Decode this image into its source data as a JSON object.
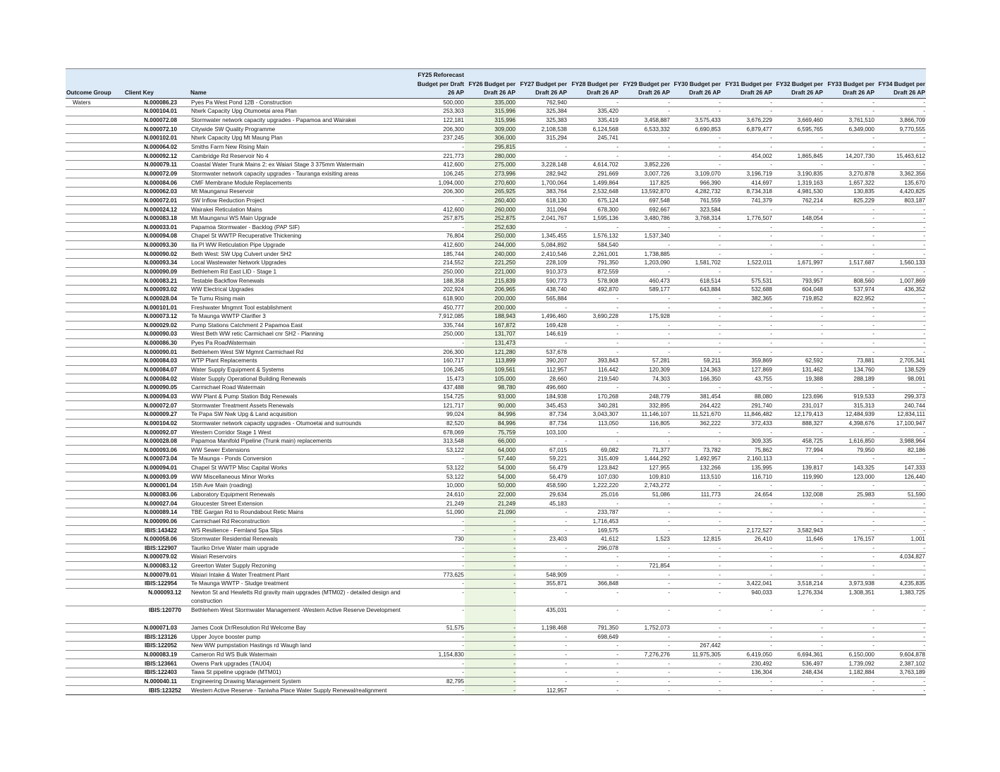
{
  "headers": {
    "outcome_group": "Outcome Group",
    "client_key": "Client Key",
    "name": "Name",
    "fy25": "FY25 Reforecast Budget per Draft 26 AP",
    "fy26": "FY26 Budget per Draft 26 AP",
    "fy27": "FY27 Budget per Draft 26 AP",
    "fy28": "FY28 Budget per Draft 26 AP",
    "fy29": "FY29 Budget per Draft 26 AP",
    "fy30": "FY30 Budget per Draft 26 AP",
    "fy31": "FY31 Budget per Draft 26 AP",
    "fy32": "FY32 Budget per Draft 26 AP",
    "fy33": "FY33 Budget per Draft 26 AP",
    "fy34": "FY34 Budget per Draft 26 AP"
  },
  "colors": {
    "header_bg": "#dce9f6",
    "fy26_highlight": "#ebf5e2"
  },
  "rows": [
    [
      "Waters",
      "N.000086.23",
      "Pyes Pa West Pond 12B - Construction",
      "500,000",
      "335,000",
      "762,940",
      "-",
      "-",
      "-",
      "-",
      "-",
      "-",
      "-"
    ],
    [
      "",
      "N.000104.01",
      "Ntwrk Capacity Upg Otumoetai area Plan",
      "253,303",
      "315,996",
      "325,384",
      "335,420",
      "-",
      "-",
      "-",
      "-",
      "-",
      "-"
    ],
    [
      "",
      "N.000072.08",
      "Stormwater network capacity upgrades - Papamoa and Wairakei",
      "122,181",
      "315,996",
      "325,383",
      "335,419",
      "3,458,887",
      "3,575,433",
      "3,676,229",
      "3,669,460",
      "3,761,510",
      "3,866,709"
    ],
    [
      "",
      "N.000072.10",
      "Citywide SW Quality Programme",
      "206,300",
      "309,000",
      "2,108,538",
      "6,124,568",
      "6,533,332",
      "6,690,853",
      "6,879,477",
      "6,595,765",
      "6,349,000",
      "9,770,555"
    ],
    [
      "",
      "N.000102.01",
      "Ntwrk Capacity Upg Mt Maung Plan",
      "237,245",
      "306,000",
      "315,294",
      "245,741",
      "-",
      "-",
      "-",
      "-",
      "-",
      "-"
    ],
    [
      "",
      "N.000064.02",
      "Smiths Farm New Rising Main",
      "-",
      "295,815",
      "-",
      "-",
      "-",
      "-",
      "-",
      "-",
      "-",
      "-"
    ],
    [
      "",
      "N.000092.12",
      "Cambridge Rd Reservoir No 4",
      "221,773",
      "280,000",
      "-",
      "-",
      "-",
      "-",
      "454,002",
      "1,865,845",
      "14,207,730",
      "15,463,612"
    ],
    [
      "",
      "N.000079.11",
      "Coastal Water Trunk Mains 2: ex Waiari Stage 3 375mm Watermain",
      "412,600",
      "275,000",
      "3,228,148",
      "4,614,702",
      "3,852,226",
      "-",
      "-",
      "-",
      "-",
      "-"
    ],
    [
      "",
      "N.000072.09",
      "Stormwater network capacity upgrades - Tauranga exisiting areas",
      "106,245",
      "273,996",
      "282,942",
      "291,669",
      "3,007,726",
      "3,109,070",
      "3,196,719",
      "3,190,835",
      "3,270,878",
      "3,362,356"
    ],
    [
      "",
      "N.000084.06",
      "CMF Membrane Module Replacements",
      "1,094,000",
      "270,600",
      "1,700,064",
      "1,499,864",
      "117,825",
      "966,390",
      "414,697",
      "1,319,163",
      "1,657,322",
      "135,670"
    ],
    [
      "",
      "N.000062.03",
      "Mt Maunganui Reservoir",
      "206,300",
      "265,925",
      "383,764",
      "2,532,648",
      "13,592,870",
      "4,282,732",
      "8,734,318",
      "4,981,530",
      "130,835",
      "4,420,825"
    ],
    [
      "",
      "N.000072.01",
      "SW Inflow Reduction Project",
      "-",
      "260,400",
      "618,130",
      "675,124",
      "697,548",
      "761,559",
      "741,379",
      "762,214",
      "825,229",
      "803,187"
    ],
    [
      "",
      "N.000024.12",
      "Wairakei Reticulation Mains",
      "412,600",
      "260,000",
      "311,094",
      "678,300",
      "692,667",
      "323,584",
      "-",
      "-",
      "-",
      "-"
    ],
    [
      "",
      "N.000083.18",
      "Mt Maunganui WS Main Upgrade",
      "257,875",
      "252,875",
      "2,041,767",
      "1,595,136",
      "3,480,786",
      "3,768,314",
      "1,776,507",
      "148,054",
      "-",
      "-"
    ],
    [
      "",
      "N.000033.01",
      "Papamoa Stormwater - Backlog (PAP SIF)",
      "-",
      "252,630",
      "-",
      "-",
      "-",
      "-",
      "-",
      "-",
      "-",
      "-"
    ],
    [
      "",
      "N.000094.08",
      "Chapel St WWTP Recuperative Thickening",
      "76,804",
      "250,000",
      "1,345,455",
      "1,576,132",
      "1,537,340",
      "-",
      "-",
      "-",
      "-",
      "-"
    ],
    [
      "",
      "N.000093.30",
      "Ila Pl WW Reticulation Pipe Upgrade",
      "412,600",
      "244,000",
      "5,084,892",
      "584,540",
      "-",
      "-",
      "-",
      "-",
      "-",
      "-"
    ],
    [
      "",
      "N.000090.02",
      "Beth West: SW Upg Culvert under SH2",
      "185,744",
      "240,000",
      "2,410,546",
      "2,261,001",
      "1,738,885",
      "-",
      "-",
      "-",
      "-",
      "-"
    ],
    [
      "",
      "N.000093.34",
      "Local Wastewater Network Upgrades",
      "214,552",
      "221,250",
      "228,109",
      "791,350",
      "1,203,090",
      "1,581,702",
      "1,522,011",
      "1,671,997",
      "1,517,687",
      "1,560,133"
    ],
    [
      "",
      "N.000090.09",
      "Bethlehem Rd East LID - Stage 1",
      "250,000",
      "221,000",
      "910,373",
      "872,559",
      "-",
      "-",
      "-",
      "-",
      "-",
      "-"
    ],
    [
      "",
      "N.000083.21",
      "Testable Backflow Renewals",
      "188,358",
      "215,839",
      "590,773",
      "578,908",
      "460,473",
      "618,514",
      "575,531",
      "793,957",
      "808,560",
      "1,007,869"
    ],
    [
      "",
      "N.000093.02",
      "WW Electrical Upgrades",
      "202,924",
      "206,965",
      "438,740",
      "492,870",
      "589,177",
      "643,884",
      "532,688",
      "604,048",
      "537,974",
      "436,352"
    ],
    [
      "",
      "N.000028.04",
      "Te Tumu Rising main",
      "618,900",
      "200,000",
      "565,884",
      "-",
      "-",
      "-",
      "382,365",
      "719,852",
      "822,952",
      "-"
    ],
    [
      "",
      "N.000101.01",
      "Freshwater Mngmnt Tool establishment",
      "450,777",
      "200,000",
      "-",
      "-",
      "-",
      "-",
      "-",
      "-",
      "-",
      "-"
    ],
    [
      "",
      "N.000073.12",
      "Te Maunga WWTP Clarifier 3",
      "7,912,085",
      "188,943",
      "1,496,460",
      "3,690,228",
      "175,928",
      "-",
      "-",
      "-",
      "-",
      "-"
    ],
    [
      "",
      "N.000029.02",
      "Pump Stations Catchment 2 Papamoa East",
      "335,744",
      "167,872",
      "169,428",
      "-",
      "-",
      "-",
      "-",
      "-",
      "-",
      "-"
    ],
    [
      "",
      "N.000090.03",
      "West Beth WW retic Carmichael cnr SH2 - Planning",
      "250,000",
      "131,707",
      "146,619",
      "-",
      "-",
      "-",
      "-",
      "-",
      "-",
      "-"
    ],
    [
      "",
      "N.000086.30",
      "Pyes Pa RoadWatermain",
      "-",
      "131,473",
      "-",
      "-",
      "-",
      "-",
      "-",
      "-",
      "-",
      "-"
    ],
    [
      "",
      "N.000090.01",
      "Bethlehem West SW Mgmnt Carmichael Rd",
      "206,300",
      "121,280",
      "537,678",
      "-",
      "-",
      "-",
      "-",
      "-",
      "-",
      "-"
    ],
    [
      "",
      "N.000084.03",
      "WTP Plant Replacements",
      "160,717",
      "113,899",
      "390,207",
      "393,843",
      "57,281",
      "59,211",
      "359,869",
      "62,592",
      "73,881",
      "2,705,341"
    ],
    [
      "",
      "N.000084.07",
      "Water Supply Equipment & Systems",
      "106,245",
      "109,561",
      "112,957",
      "116,442",
      "120,309",
      "124,363",
      "127,869",
      "131,462",
      "134,760",
      "138,529"
    ],
    [
      "",
      "N.000084.02",
      "Water Supply Operational Building Renewals",
      "15,473",
      "105,000",
      "28,660",
      "219,540",
      "74,303",
      "166,350",
      "43,755",
      "19,388",
      "288,189",
      "98,091"
    ],
    [
      "",
      "N.000090.05",
      "Carmichael Road Watermain",
      "437,488",
      "98,780",
      "496,660",
      "-",
      "-",
      "-",
      "-",
      "-",
      "-",
      "-"
    ],
    [
      "",
      "N.000094.03",
      "WW Plant & Pump Station Bdg Renewals",
      "154,725",
      "93,000",
      "184,938",
      "170,268",
      "248,779",
      "381,454",
      "88,080",
      "123,696",
      "919,533",
      "299,373"
    ],
    [
      "",
      "N.000072.07",
      "Stormwater Treatment Assets Renewals",
      "121,717",
      "90,000",
      "345,453",
      "340,281",
      "332,895",
      "264,422",
      "291,740",
      "231,017",
      "315,313",
      "240,744"
    ],
    [
      "",
      "N.000009.27",
      "Te Papa SW Nwk Upg & Land acquisition",
      "99,024",
      "84,996",
      "87,734",
      "3,043,307",
      "11,146,107",
      "11,521,670",
      "11,846,482",
      "12,179,413",
      "12,484,939",
      "12,834,111"
    ],
    [
      "",
      "N.000104.02",
      "Stormwater network capacity upgrades - Otumoetai and surrounds",
      "82,520",
      "84,996",
      "87,734",
      "113,050",
      "116,805",
      "362,222",
      "372,433",
      "888,327",
      "4,398,676",
      "17,100,947"
    ],
    [
      "",
      "N.000092.07",
      "Western Corridor Stage 1  West",
      "678,069",
      "75,759",
      "103,100",
      "-",
      "-",
      "-",
      "-",
      "-",
      "-",
      "-"
    ],
    [
      "",
      "N.000028.08",
      "Papamoa Manifold Pipeline (Trunk main) replacements",
      "313,548",
      "66,000",
      "-",
      "-",
      "-",
      "-",
      "309,335",
      "458,725",
      "1,616,850",
      "3,988,964"
    ],
    [
      "",
      "N.000093.06",
      "WW Sewer Extensions",
      "53,122",
      "64,000",
      "67,015",
      "69,082",
      "71,377",
      "73,782",
      "75,862",
      "77,994",
      "79,950",
      "82,186"
    ],
    [
      "",
      "N.000073.04",
      "Te Maunga - Ponds Conversion",
      "-",
      "57,440",
      "59,221",
      "315,409",
      "1,444,292",
      "1,492,957",
      "2,160,113",
      "-",
      "-",
      "-"
    ],
    [
      "",
      "N.000094.01",
      "Chapel St WWTP Misc Capital Works",
      "53,122",
      "54,000",
      "56,479",
      "123,842",
      "127,955",
      "132,266",
      "135,995",
      "139,817",
      "143,325",
      "147,333"
    ],
    [
      "",
      "N.000093.09",
      "WW Miscellaneous Minor Works",
      "53,122",
      "54,000",
      "56,479",
      "107,030",
      "109,810",
      "113,510",
      "116,710",
      "119,990",
      "123,000",
      "126,440"
    ],
    [
      "",
      "N.000001.04",
      "15th Ave Main (roading)",
      "10,000",
      "50,000",
      "458,590",
      "1,222,220",
      "2,743,272",
      "-",
      "-",
      "-",
      "-",
      "-"
    ],
    [
      "",
      "N.000083.06",
      "Laboratory Equipment Renewals",
      "24,610",
      "22,000",
      "29,634",
      "25,016",
      "51,086",
      "111,773",
      "24,654",
      "132,008",
      "25,983",
      "51,590"
    ],
    [
      "",
      "N.000027.04",
      "Gloucester Street Extension",
      "21,249",
      "21,249",
      "45,183",
      "-",
      "-",
      "-",
      "-",
      "-",
      "-",
      "-"
    ],
    [
      "",
      "N.000089.14",
      "TBE Gargan Rd to Roundabout Retic Mains",
      "51,090",
      "21,090",
      "-",
      "233,787",
      "-",
      "-",
      "-",
      "-",
      "-",
      "-"
    ],
    [
      "",
      "N.000090.06",
      "Carmichael Rd Reconstruction",
      "-",
      "-",
      "-",
      "1,716,453",
      "-",
      "-",
      "-",
      "-",
      "-",
      "-"
    ],
    [
      "",
      "IBIS:143422",
      "WS Resilience - Fernland Spa Slips",
      "-",
      "-",
      "-",
      "169,575",
      "-",
      "-",
      "2,172,527",
      "3,582,943",
      "-",
      "-"
    ],
    [
      "",
      "N.000058.06",
      "Stormwater Residential Renewals",
      "730",
      "-",
      "23,403",
      "41,612",
      "1,523",
      "12,815",
      "26,410",
      "11,646",
      "176,157",
      "1,001"
    ],
    [
      "",
      "IBIS:122907",
      "Tauriko Drive Water main upgrade",
      "-",
      "-",
      "-",
      "296,078",
      "-",
      "-",
      "-",
      "-",
      "-",
      "-"
    ],
    [
      "",
      "N.000079.02",
      "Waiari Reservoirs",
      "-",
      "-",
      "-",
      "-",
      "-",
      "-",
      "-",
      "-",
      "-",
      "4,034,827"
    ],
    [
      "",
      "N.000083.12",
      "Greerton Water Supply Rezoning",
      "-",
      "-",
      "-",
      "-",
      "721,854",
      "-",
      "-",
      "-",
      "-",
      "-"
    ],
    [
      "",
      "N.000079.01",
      "Waiari Intake & Water Treatment Plant",
      "773,625",
      "-",
      "548,909",
      "-",
      "-",
      "-",
      "-",
      "-",
      "-",
      "-"
    ],
    [
      "",
      "IBIS:122954",
      "Te Maunga WWTP -  Sludge treatment",
      "-",
      "-",
      "355,871",
      "366,848",
      "-",
      "-",
      "3,422,041",
      "3,518,214",
      "3,973,938",
      "4,235,835"
    ],
    [
      "",
      "N.000093.12",
      "Newton St and Hewletts Rd gravity main upgrades (MTM02) - detailed design and construction",
      "-",
      "-",
      "-",
      "-",
      "-",
      "-",
      "940,033",
      "1,276,334",
      "1,308,351",
      "1,383,725"
    ],
    [
      "",
      "IBIS:120770",
      "Bethlehem West Stormwater Management -Western Active Reserve Development",
      "-",
      "-",
      "435,031",
      "-",
      "-",
      "-",
      "-",
      "-",
      "-",
      "-"
    ],
    [
      "",
      "N.000071.03",
      "James Cook Dr/Resolution Rd Welcome Bay",
      "51,575",
      "-",
      "1,198,468",
      "791,350",
      "1,752,073",
      "-",
      "-",
      "-",
      "-",
      "-"
    ],
    [
      "",
      "IBIS:123126",
      "Upper Joyce booster pump",
      "-",
      "-",
      "-",
      "698,649",
      "-",
      "-",
      "-",
      "-",
      "-",
      "-"
    ],
    [
      "",
      "IBIS:122052",
      "New WW pumpstation Hastings rd Waugh land",
      "-",
      "-",
      "-",
      "-",
      "-",
      "267,442",
      "-",
      "-",
      "-",
      "-"
    ],
    [
      "",
      "N.000083.19",
      "Cameron Rd WS Bulk Watermain",
      "1,154,830",
      "-",
      "-",
      "-",
      "7,276,276",
      "11,975,305",
      "6,419,050",
      "6,694,361",
      "6,150,000",
      "9,604,878"
    ],
    [
      "",
      "IBIS:123661",
      "Owens Park upgrades (TAU04)",
      "-",
      "-",
      "-",
      "-",
      "-",
      "-",
      "230,492",
      "536,497",
      "1,739,092",
      "2,387,102"
    ],
    [
      "",
      "IBIS:122403",
      "Tawa St pipeline upgrade (MTM01)",
      "-",
      "-",
      "-",
      "-",
      "-",
      "-",
      "136,304",
      "248,434",
      "1,182,884",
      "3,763,189"
    ],
    [
      "",
      "N.000040.11",
      "Engineering Drawing Management System",
      "82,795",
      "-",
      "-",
      "-",
      "-",
      "-",
      "-",
      "-",
      "-",
      "-"
    ],
    [
      "",
      "IBIS:123252",
      "Western Active Reserve - Taniwha Place Water Supply Renewal/realignment",
      "-",
      "-",
      "112,957",
      "-",
      "-",
      "-",
      "-",
      "-",
      "-",
      "-"
    ]
  ]
}
